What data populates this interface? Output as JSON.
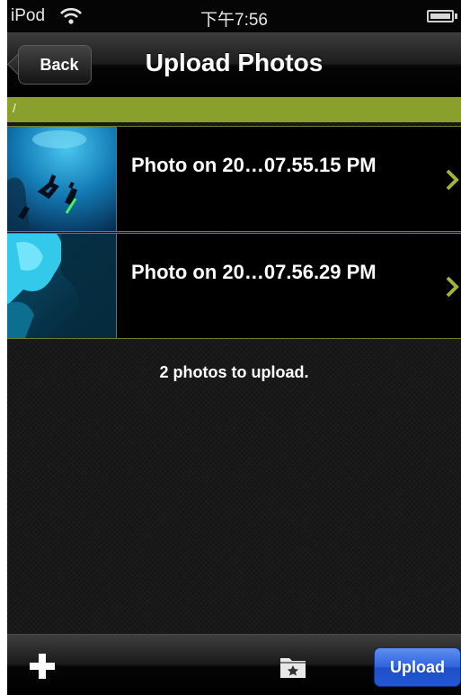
{
  "status_bar": {
    "carrier": "iPod",
    "time": "下午7:56",
    "wifi_icon": "wifi-icon",
    "battery_icon": "battery-icon"
  },
  "nav": {
    "back_label": "Back",
    "title": "Upload Photos"
  },
  "path": {
    "label": "/",
    "color": "#8aa02c"
  },
  "photos": [
    {
      "label": "Photo on 20…07.55.15 PM",
      "icon": "chevron-right-icon"
    },
    {
      "label": "Photo on 20…07.56.29 PM",
      "icon": "chevron-right-icon"
    }
  ],
  "summary": "2 photos to upload.",
  "toolbar": {
    "add_icon": "plus-icon",
    "folder_icon": "folder-icon",
    "upload_label": "Upload",
    "upload_color": "#2d62dc"
  }
}
